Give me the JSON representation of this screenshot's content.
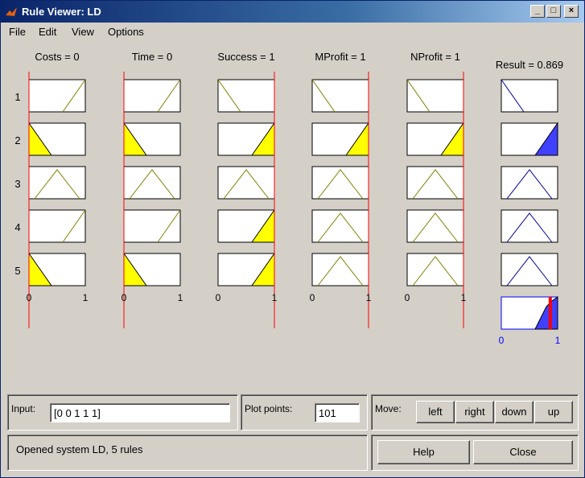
{
  "window": {
    "title": "Rule Viewer: LD"
  },
  "menu": [
    "File",
    "Edit",
    "View",
    "Options"
  ],
  "inputs": [
    {
      "label": "Costs = 0"
    },
    {
      "label": "Time = 0"
    },
    {
      "label": "Success = 1"
    },
    {
      "label": "MProfit = 1"
    },
    {
      "label": "NProfit = 1"
    }
  ],
  "output": {
    "label": "Result = 0.869",
    "value": 0.869
  },
  "rule_numbers": [
    "1",
    "2",
    "3",
    "4",
    "5"
  ],
  "axis_ticks": {
    "min": "0",
    "max": "1"
  },
  "controls": {
    "input_label": "Input:",
    "input_value": "[0 0 1 1 1]",
    "plot_points_label": "Plot points:",
    "plot_points_value": "101",
    "move_label": "Move:",
    "move_buttons": [
      "left",
      "right",
      "down",
      "up"
    ],
    "status": "Opened system LD, 5 rules",
    "help_label": "Help",
    "close_label": "Close"
  },
  "colors": {
    "input_fill": "#ffff00",
    "output_fill": "#4040ff",
    "mf_line_input": "#808000",
    "mf_line_output": "#0000a0",
    "marker": "#ff0000"
  }
}
